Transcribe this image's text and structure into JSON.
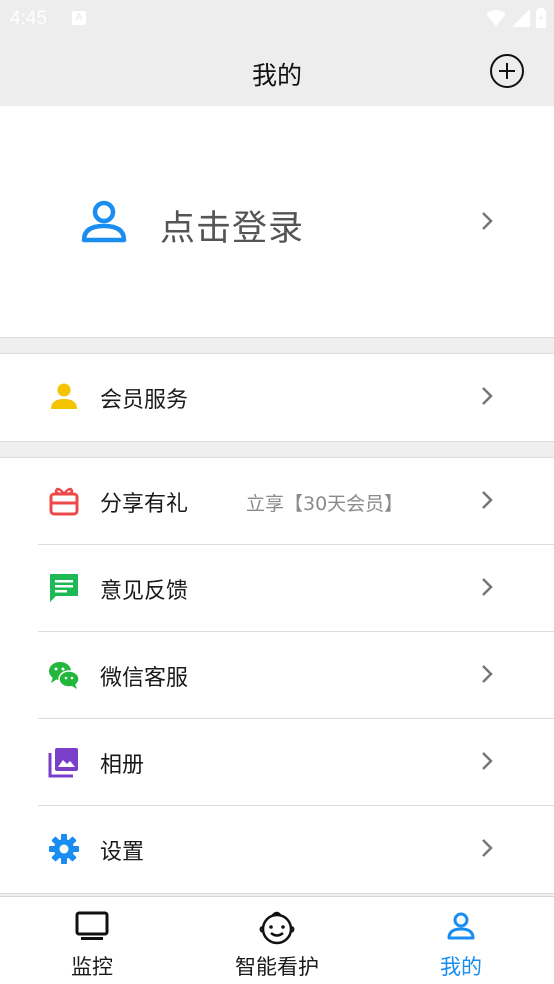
{
  "status_bar": {
    "time": "4:45",
    "notification_letter": "A"
  },
  "header": {
    "title": "我的",
    "add_icon": "plus-circle-icon"
  },
  "login": {
    "label": "点击登录",
    "icon": "user-icon"
  },
  "membership_section": [
    {
      "label": "会员服务",
      "icon": "member-icon",
      "color": "#f5c400"
    }
  ],
  "menu_section": [
    {
      "label": "分享有礼",
      "icon": "gift-icon",
      "color": "#f04848",
      "extra": "立享【30天会员】"
    },
    {
      "label": "意见反馈",
      "icon": "feedback-icon",
      "color": "#1db954"
    },
    {
      "label": "微信客服",
      "icon": "wechat-icon",
      "color": "#22b63a"
    },
    {
      "label": "相册",
      "icon": "album-icon",
      "color": "#7a3fc9"
    },
    {
      "label": "设置",
      "icon": "gear-icon",
      "color": "#1a8ef0"
    }
  ],
  "bottom_nav": [
    {
      "label": "监控",
      "icon": "monitor-icon",
      "active": false
    },
    {
      "label": "智能看护",
      "icon": "baby-face-icon",
      "active": false
    },
    {
      "label": "我的",
      "icon": "user-icon",
      "active": true
    }
  ],
  "colors": {
    "accent": "#1a8ef0",
    "header_bg": "#ededed"
  }
}
